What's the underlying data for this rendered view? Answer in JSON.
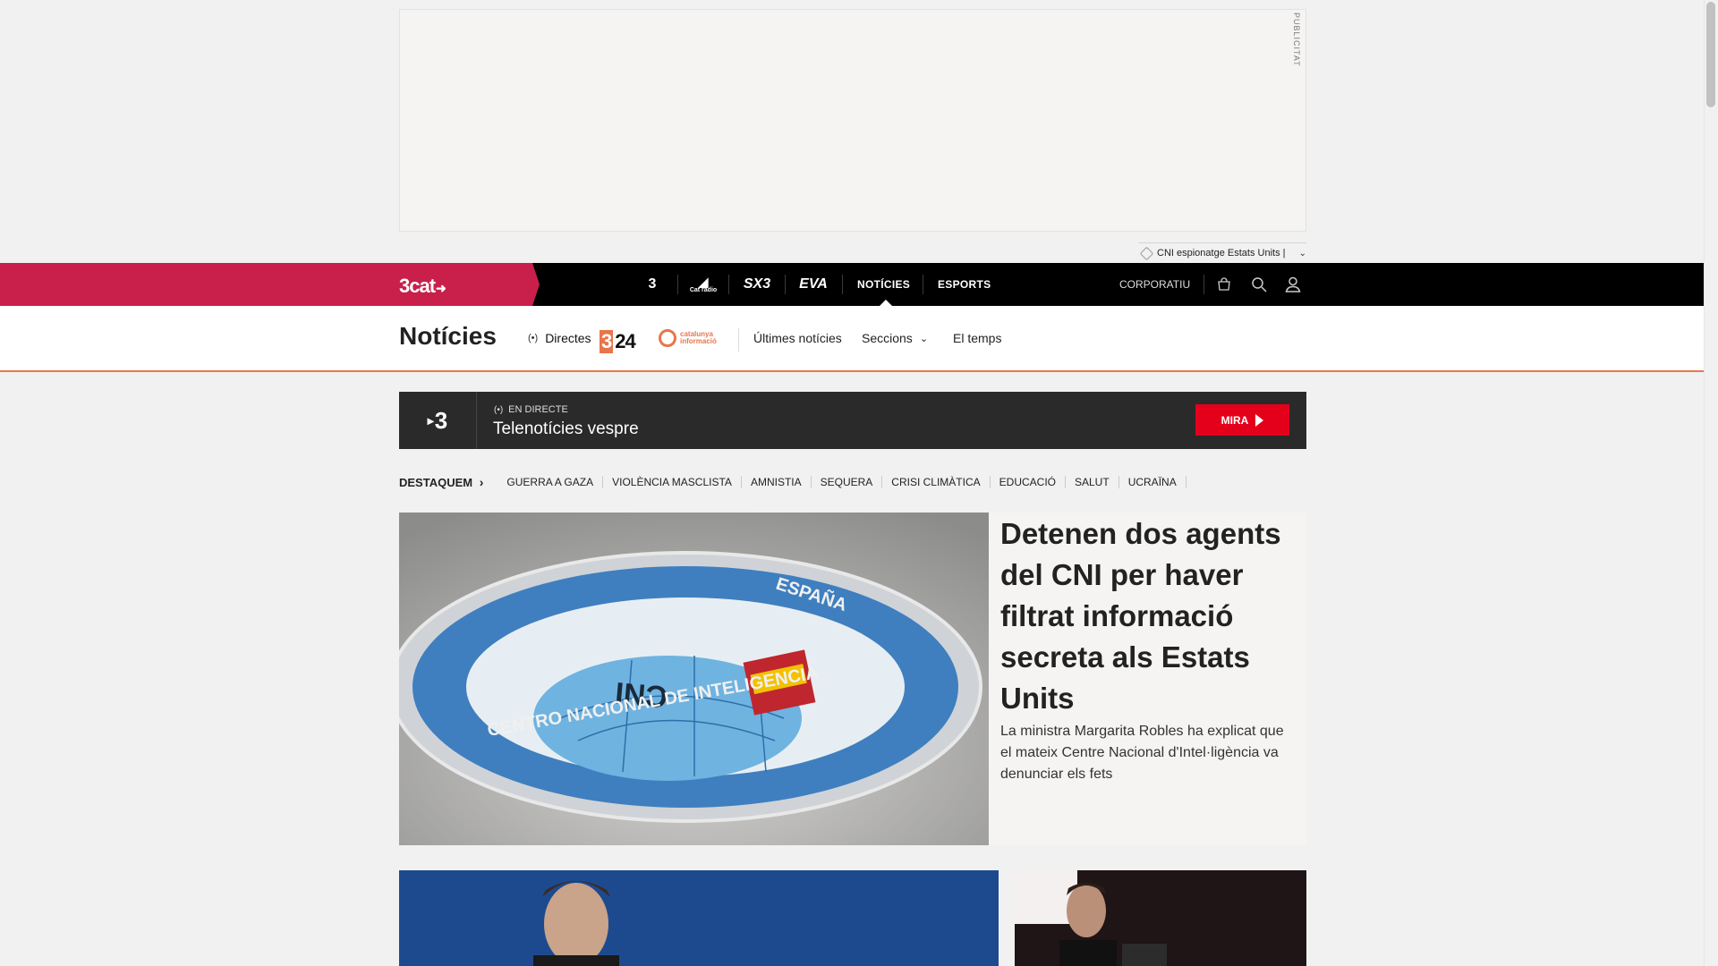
{
  "ad": {
    "label": "PUBLICITAT",
    "tag_text": "CNI espionatge Estats Units |"
  },
  "topnav": {
    "logo": "3cat",
    "channels": [
      {
        "name": "TV3",
        "text": "3"
      },
      {
        "name": "Catalunya Ràdio",
        "text": "Cat ràdio"
      },
      {
        "name": "SX3",
        "text": "SX3"
      },
      {
        "name": "EVA",
        "text": "EVA"
      }
    ],
    "links": [
      "NOTÍCIES",
      "ESPORTS"
    ],
    "active_link": "NOTÍCIES",
    "corporate": "CORPORATIU",
    "icons": [
      "shop-icon",
      "search-icon",
      "user-icon"
    ]
  },
  "section": {
    "title": "Notícies",
    "directes": "Directes",
    "channel_324": "324",
    "channel_ci": "catalunya informació",
    "links": [
      "Últimes notícies",
      "Seccions",
      "El temps"
    ]
  },
  "live": {
    "channel": "3",
    "label": "EN DIRECTE",
    "title": "Telenotícies vespre",
    "button": "MIRA"
  },
  "destaquem": {
    "heading": "DESTAQUEM",
    "items": [
      "GUERRA A GAZA",
      "VIOLÈNCIA MASCLISTA",
      "AMNISTIA",
      "SEQUERA",
      "CRISI CLIMÀTICA",
      "EDUCACIÓ",
      "SALUT",
      "UCRAÏNA"
    ]
  },
  "main_story": {
    "headline": "Detenen dos agents del CNI per haver filtrat informació secreta als Estats Units",
    "summary": "La ministra Margarita Robles ha explicat que el mateix Centre Nacional d'Intel·ligència va denunciar els fets",
    "image_seal_top": "ESPAÑA",
    "image_seal_bottom": "CENTRO NACIONAL DE INTELIGENCIA",
    "image_seal_center": "CNI"
  },
  "colors": {
    "brand": "#c8204b",
    "accent": "#e8764c",
    "live_button": "#e4001b"
  }
}
